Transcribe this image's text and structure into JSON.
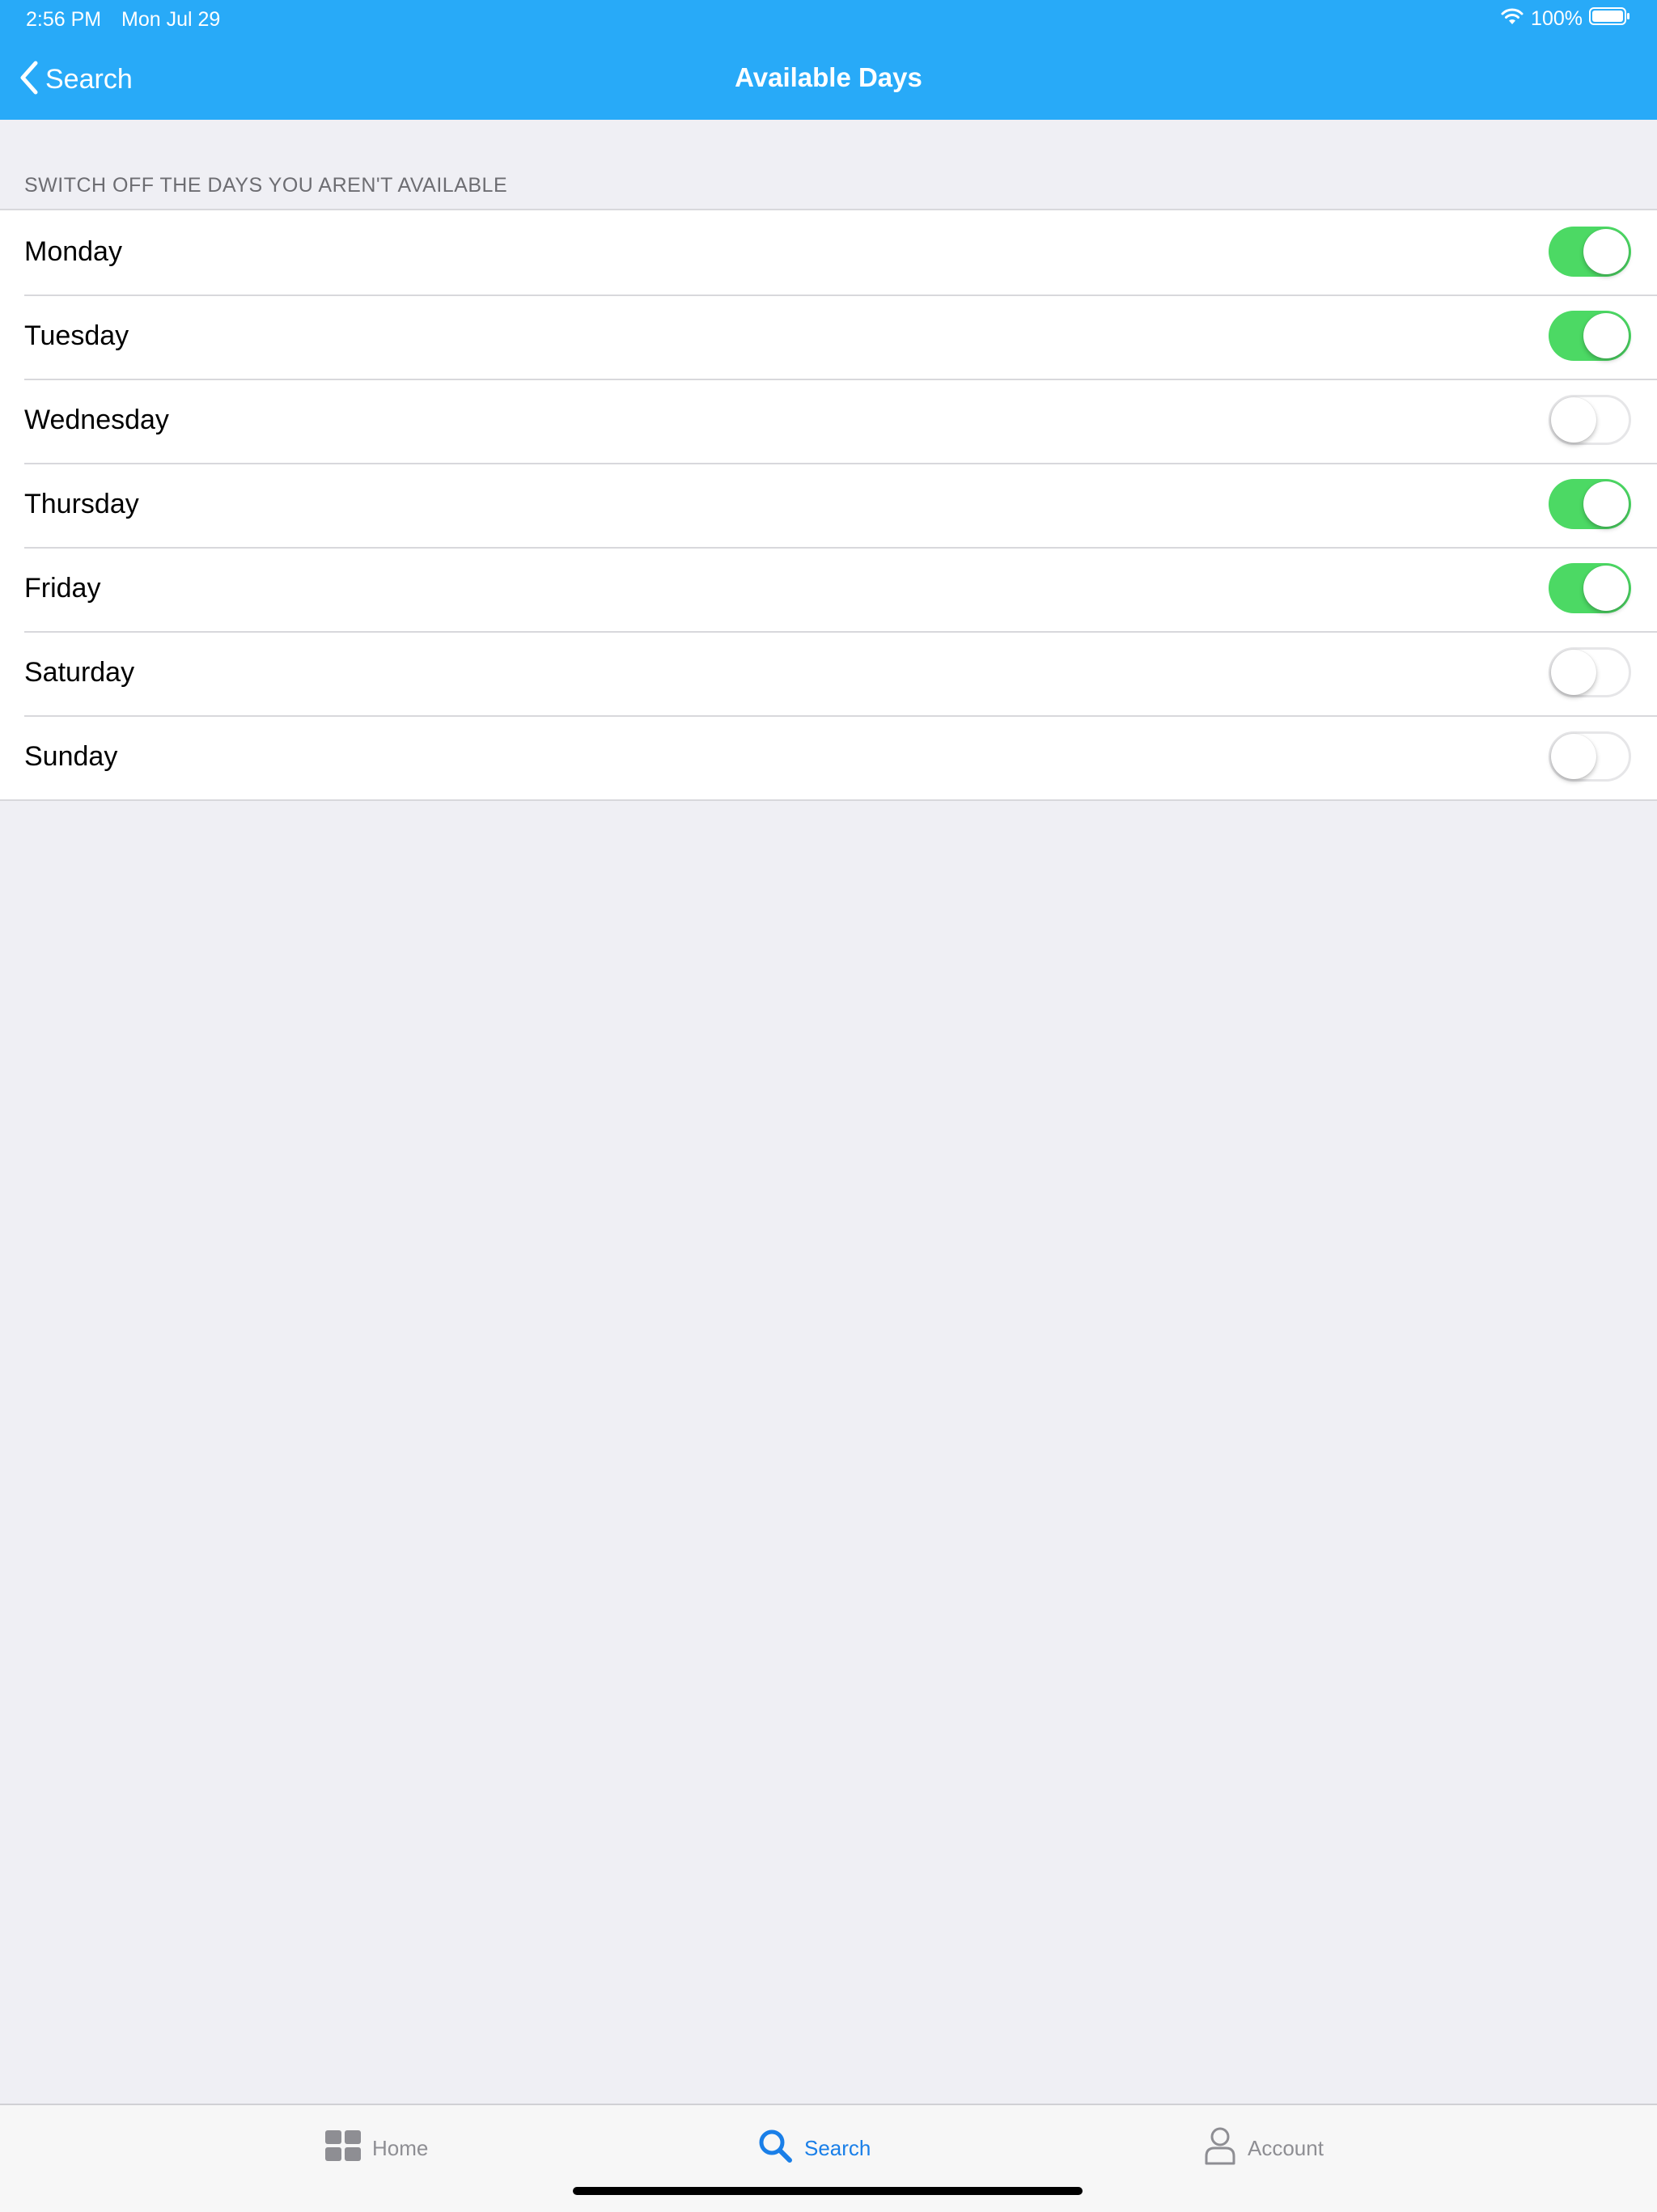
{
  "status_bar": {
    "time": "2:56 PM",
    "date": "Mon Jul 29",
    "battery": "100%"
  },
  "nav": {
    "back_label": "Search",
    "title": "Available Days"
  },
  "section": {
    "header": "SWITCH OFF THE DAYS YOU AREN'T AVAILABLE"
  },
  "days": [
    {
      "label": "Monday",
      "on": true
    },
    {
      "label": "Tuesday",
      "on": true
    },
    {
      "label": "Wednesday",
      "on": false
    },
    {
      "label": "Thursday",
      "on": true
    },
    {
      "label": "Friday",
      "on": true
    },
    {
      "label": "Saturday",
      "on": false
    },
    {
      "label": "Sunday",
      "on": false
    }
  ],
  "tabbar": {
    "home": {
      "label": "Home",
      "icon": "grid-icon"
    },
    "search": {
      "label": "Search",
      "icon": "search-icon",
      "selected": true
    },
    "account": {
      "label": "Account",
      "icon": "person-icon"
    }
  },
  "colors": {
    "header_bg": "#28aaf8",
    "switch_on": "#4cd964",
    "tab_active": "#1a7fe8",
    "tab_inactive": "#8e8e93"
  }
}
